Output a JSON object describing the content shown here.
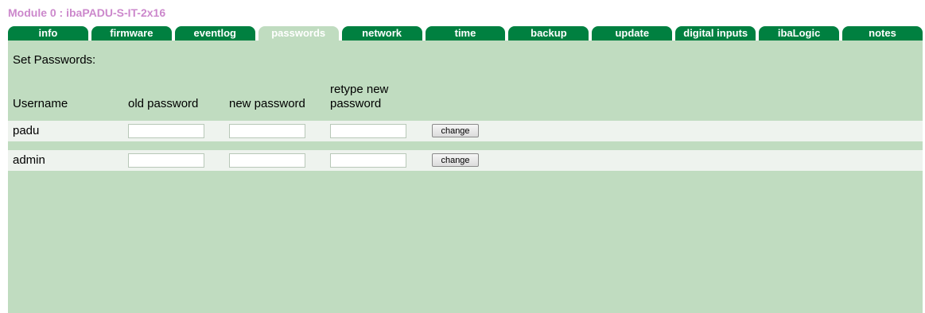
{
  "module_title": "Module 0 : ibaPADU-S-IT-2x16",
  "tabs": [
    {
      "label": "info"
    },
    {
      "label": "firmware"
    },
    {
      "label": "eventlog"
    },
    {
      "label": "passwords"
    },
    {
      "label": "network"
    },
    {
      "label": "time"
    },
    {
      "label": "backup"
    },
    {
      "label": "update"
    },
    {
      "label": "digital inputs"
    },
    {
      "label": "ibaLogic"
    },
    {
      "label": "notes"
    }
  ],
  "active_tab": "passwords",
  "colors": {
    "tab_bg": "#008040",
    "panel_bg": "#c0dcc0",
    "row_bg": "#eef3ee",
    "title": "#cc88cc"
  },
  "passwords": {
    "heading": "Set Passwords:",
    "columns": {
      "username": "Username",
      "old": "old password",
      "new": "new password",
      "retype_line1": "retype new",
      "retype_line2": "password"
    },
    "rows": [
      {
        "username": "padu",
        "old": "",
        "new": "",
        "retype": "",
        "button": "change"
      },
      {
        "username": "admin",
        "old": "",
        "new": "",
        "retype": "",
        "button": "change"
      }
    ]
  }
}
